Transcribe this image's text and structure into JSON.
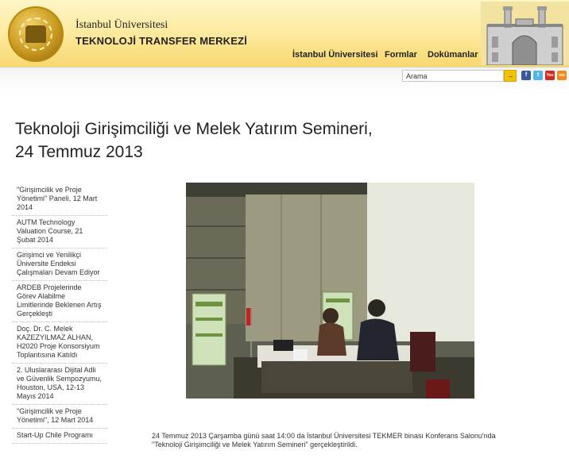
{
  "header": {
    "title_line1": "İstanbul Üniversitesi",
    "title_line2": "TEKNOLOJİ TRANSFER MERKEZİ"
  },
  "nav": {
    "items": [
      {
        "label": "İstanbul Üniversitesi"
      },
      {
        "label": "Formlar"
      },
      {
        "label": "Dokümanlar"
      }
    ]
  },
  "search": {
    "value": "Arama",
    "button_label": "→"
  },
  "social": {
    "facebook": "f",
    "twitter": "t",
    "youtube": "You",
    "rss": "rss",
    "colors": {
      "facebook": "#3b5998",
      "twitter": "#4fb6e8",
      "youtube": "#d42a1e",
      "rss": "#f18c1b"
    }
  },
  "page": {
    "title_line1": "Teknoloji Girişimciliği ve Melek Yatırım Semineri,",
    "title_line2": "24 Temmuz 2013"
  },
  "sidebar": {
    "items": [
      {
        "label": "\"Girişimcilik ve Proje Yönetimi\" Paneli, 12 Mart 2014"
      },
      {
        "label": "AUTM Technology Valuation Course, 21 Şubat 2014"
      },
      {
        "label": "Girişimci ve Yenilikçi Üniversite Endeksi Çalışmaları Devam Ediyor"
      },
      {
        "label": "ARDEB Projelerinde Görev Alabilme Limitlerinde Beklenen Artış Gerçekleşti"
      },
      {
        "label": "Doç. Dr. C. Melek KAZEZYILMAZ ALHAN, H2020 Proje Konsorsiyum Toplantısına Katıldı"
      },
      {
        "label": "2. Uluslararası Dijital Adli ve Güvenlik Sempozyumu, Houston, USA, 12-13 Mayıs 2014"
      },
      {
        "label": "\"Girişimcilik ve Proje Yönetimi\", 12 Mart 2014"
      },
      {
        "label": "Start-Up Chile Programı"
      }
    ]
  },
  "article": {
    "caption": "24 Temmuz 2013 Çarşamba günü saat 14:00 da İstanbul Üniversitesi TEKMER binası Konferans Salonu'nda \"Teknoloji Girişimciliği ve Melek Yatırım Semineri\" gerçekleştirildi."
  }
}
